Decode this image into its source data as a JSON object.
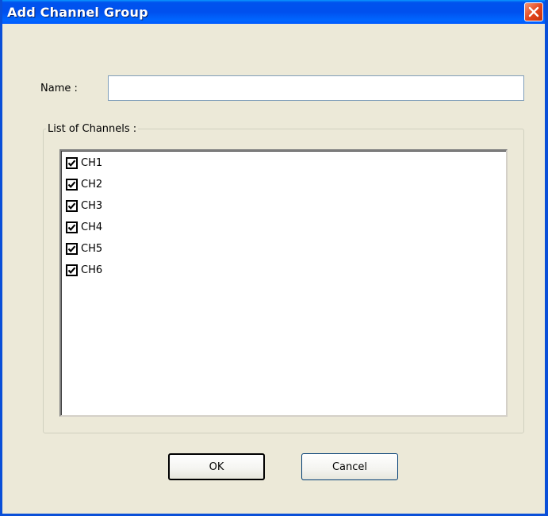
{
  "dialog": {
    "title": "Add Channel Group",
    "close_icon": "close-icon"
  },
  "form": {
    "name_label": "Name :",
    "name_value": "",
    "name_placeholder": ""
  },
  "channels": {
    "group_label": "List of Channels :",
    "items": [
      {
        "label": "CH1",
        "checked": true
      },
      {
        "label": "CH2",
        "checked": true
      },
      {
        "label": "CH3",
        "checked": true
      },
      {
        "label": "CH4",
        "checked": true
      },
      {
        "label": "CH5",
        "checked": true
      },
      {
        "label": "CH6",
        "checked": true
      }
    ]
  },
  "buttons": {
    "ok_label": "OK",
    "cancel_label": "Cancel"
  },
  "colors": {
    "titlebar": "#0050ee",
    "window_bg": "#ece9d8",
    "close_button": "#e2431a"
  }
}
